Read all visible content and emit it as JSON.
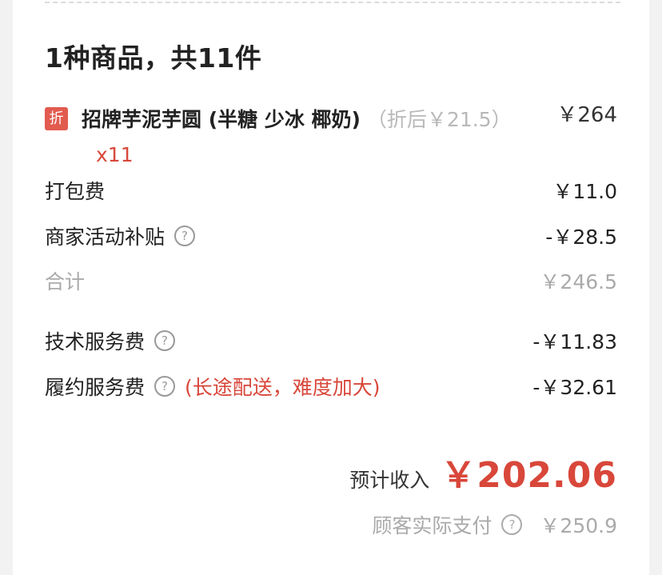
{
  "order": {
    "title": "1种商品，共11件",
    "item": {
      "tag": "折",
      "name": "招牌芋泥芋圆 (半糖 少冰 椰奶)",
      "discount_note": "（折后￥21.5）",
      "qty": "x11",
      "price": "￥264"
    },
    "packing": {
      "label": "打包费",
      "value": "￥11.0"
    },
    "subsidy": {
      "label": "商家活动补贴",
      "value": "-￥28.5"
    },
    "subtotal": {
      "label": "合计",
      "value": "￥246.5"
    },
    "tech_fee": {
      "label": "技术服务费",
      "value": "-￥11.83"
    },
    "fulfill_fee": {
      "label": "履约服务费",
      "note": "(长途配送，难度加大)",
      "value": "-￥32.61"
    },
    "income": {
      "label": "预计收入",
      "value": "￥202.06"
    },
    "paid": {
      "label": "顾客实际支付",
      "value": "￥250.9"
    }
  },
  "colors": {
    "accent": "#d8473a",
    "muted": "#aaaaaa",
    "text": "#222222"
  },
  "icons": {
    "help": "question-circle-icon"
  }
}
